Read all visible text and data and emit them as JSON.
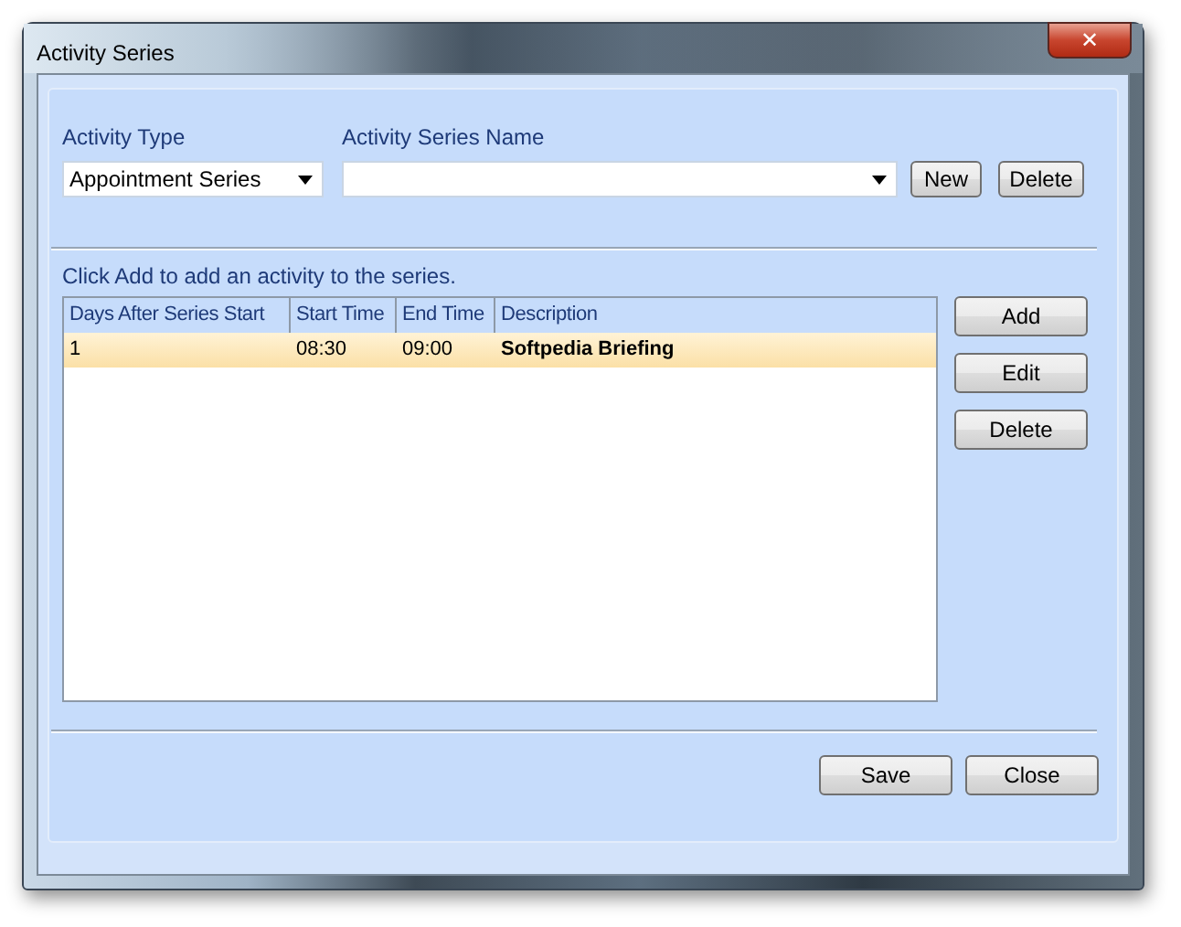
{
  "window": {
    "title": "Activity Series",
    "close": "✕"
  },
  "activity_type": {
    "label": "Activity Type",
    "value": "Appointment Series"
  },
  "activity_series_name": {
    "label": "Activity Series Name"
  },
  "name_buttons": [
    "New",
    "Delete"
  ],
  "hint": "Click Add to add an activity to the series.",
  "table": {
    "columns": [
      "Days After Series Start",
      "Start Time",
      "End Time",
      "Description"
    ],
    "rows": [
      {
        "cells": [
          "1",
          "08:30",
          "09:00",
          "Softpedia Briefing"
        ],
        "selected": true
      }
    ]
  },
  "side_buttons": [
    "Add",
    "Edit",
    "Delete"
  ],
  "footer_buttons": [
    "Save",
    "Close"
  ]
}
